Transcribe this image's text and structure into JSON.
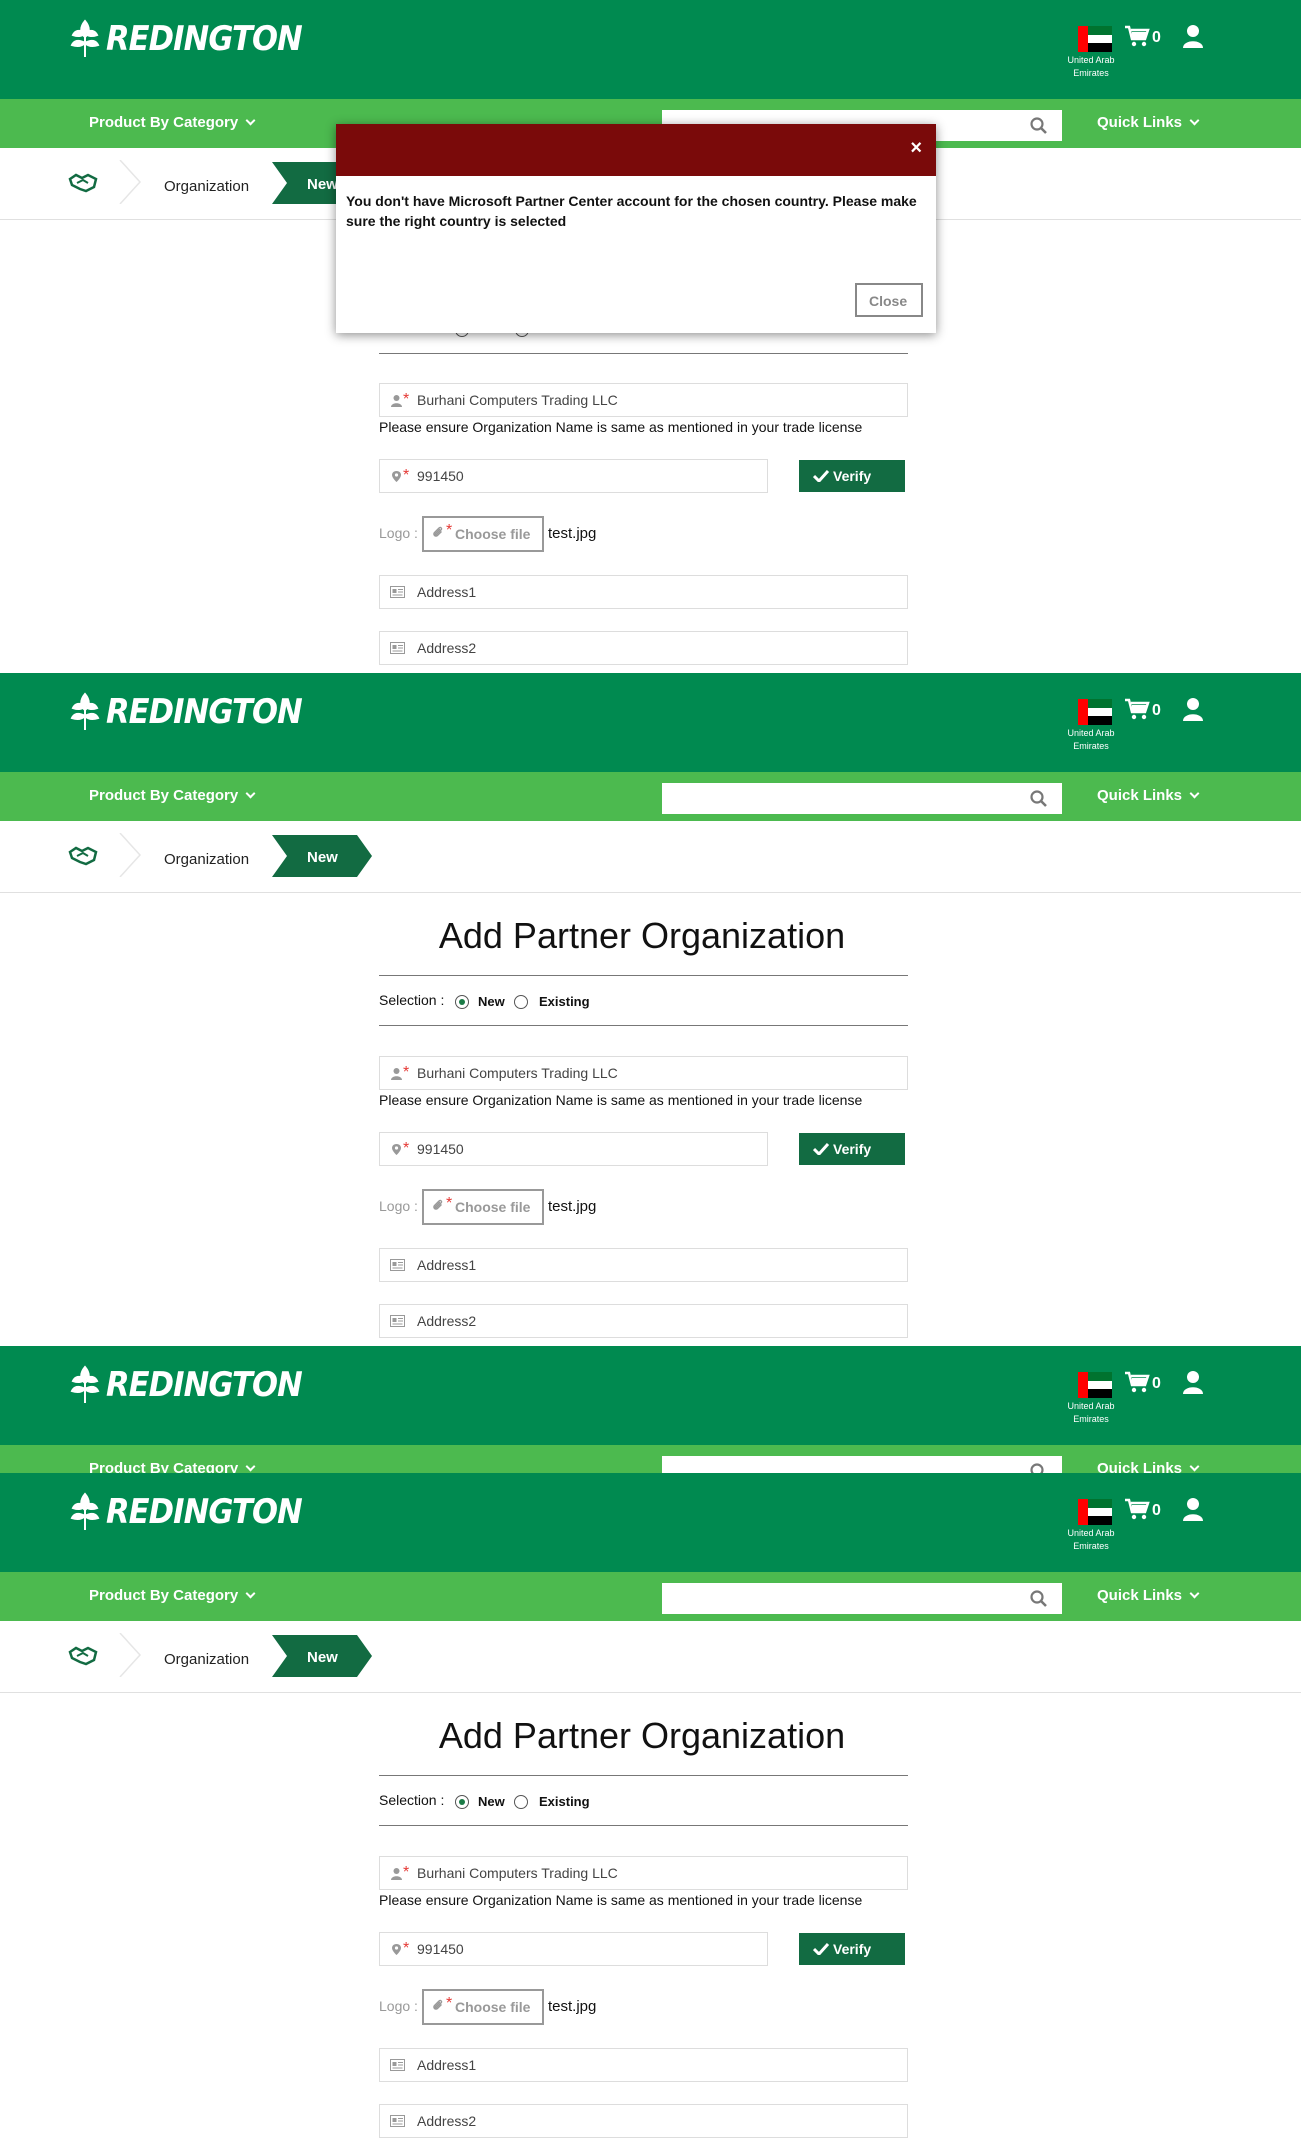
{
  "brand": {
    "name": "REDINGTON"
  },
  "header": {
    "country": "United Arab Emirates",
    "cart_count": "0"
  },
  "nav": {
    "category_label": "Product By Category",
    "search_placeholder": "",
    "quick_links_label": "Quick Links"
  },
  "breadcrumb": {
    "item_org": "Organization",
    "item_new": "New"
  },
  "form": {
    "title": "Add Partner Organization",
    "selection_label": "Selection :",
    "option_new": "New",
    "option_existing": "Existing",
    "org_name": "Burhani Computers Trading LLC",
    "org_note": "Please ensure Organization Name is same as mentioned in your trade license",
    "code": "991450",
    "verify_label": "Verify",
    "logo_label": "Logo :",
    "choose_file_label": "Choose file",
    "file_name": "test.jpg",
    "address1": "Address1",
    "address2": "Address2",
    "required_mark": "*"
  },
  "modal": {
    "close_x": "×",
    "message": "You don't have Microsoft Partner Center account for the chosen country. Please make sure the right country is selected",
    "close_label": "Close"
  },
  "colors": {
    "header": "#008a50",
    "navbar": "#4cba4f",
    "accent": "#126b42",
    "modal_header": "#7a0a0a"
  }
}
